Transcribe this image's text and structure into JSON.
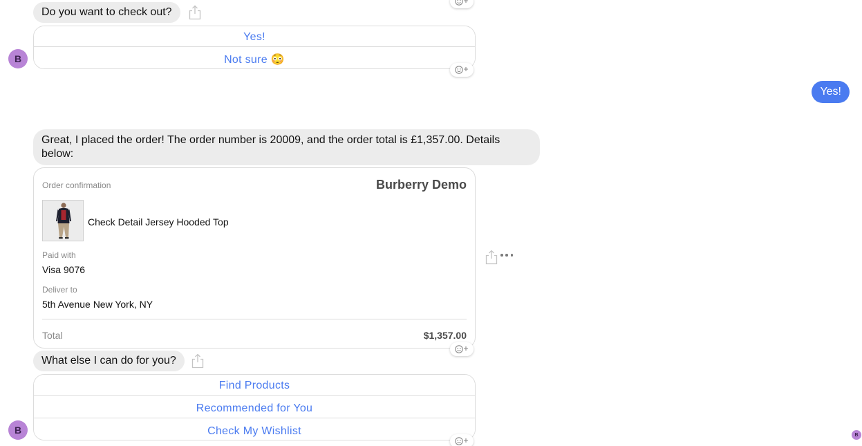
{
  "messages": {
    "checkout_question": "Do you want to check out?",
    "checkout_options": [
      "Yes!",
      "Not sure 😳"
    ],
    "user_reply": "Yes!",
    "order_placed": "Great, I placed the order! The order number is 20009, and the order total is £1,357.00. Details below:",
    "what_else": "What else I can do for you?",
    "menu_options": [
      "Find Products",
      "Recommended for You",
      "Check My Wishlist"
    ]
  },
  "order": {
    "header_label": "Order confirmation",
    "brand": "Burberry Demo",
    "product_name": "Check Detail Jersey Hooded Top",
    "paid_label": "Paid with",
    "paid_value": "Visa 9076",
    "deliver_label": "Deliver to",
    "deliver_value": "5th Avenue New York, NY",
    "total_label": "Total",
    "total_value": "$1,357.00"
  },
  "bot_avatar_initial": "B",
  "colors": {
    "accent": "#4a7bf0",
    "bot_bubble": "#ececec",
    "avatar": "#b884d6"
  },
  "icons": [
    "share-icon",
    "add-reaction-icon",
    "more-icon",
    "avatar-icon"
  ]
}
